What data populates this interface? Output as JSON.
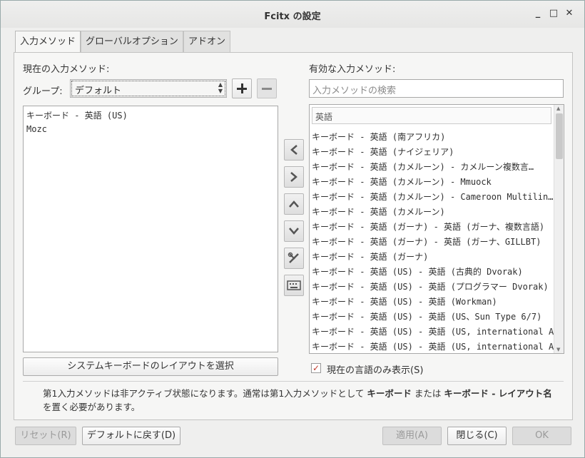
{
  "window": {
    "title": "Fcitx の設定",
    "controls": [
      "_",
      "□",
      "✕"
    ]
  },
  "tabs": [
    {
      "label": "入力メソッド",
      "active": true
    },
    {
      "label": "グローバルオプション",
      "active": false
    },
    {
      "label": "アドオン",
      "active": false
    }
  ],
  "left": {
    "heading": "現在の入力メソッド:",
    "group_label": "グループ:",
    "group_value": "デフォルト",
    "items": [
      "キーボード - 英語 (US)",
      "Mozc"
    ],
    "layout_button": "システムキーボードのレイアウトを選択"
  },
  "right": {
    "heading": "有効な入力メソッド:",
    "search_placeholder": "入力メソッドの検索",
    "group_header": "英語",
    "items": [
      "キーボード - 英語 (南アフリカ)",
      "キーボード - 英語 (ナイジェリア)",
      "キーボード - 英語 (カメルーン) - カメルーン複数言…",
      "キーボード - 英語 (カメルーン) - Mmuock",
      "キーボード - 英語 (カメルーン) - Cameroon Multilin…",
      "キーボード - 英語 (カメルーン)",
      "キーボード - 英語 (ガーナ) - 英語 (ガーナ、複数言語)",
      "キーボード - 英語 (ガーナ) - 英語 (ガーナ、GILLBT)",
      "キーボード - 英語 (ガーナ)",
      "キーボード - 英語 (US) - 英語 (古典的 Dvorak)",
      "キーボード - 英語 (US) - 英語 (プログラマー Dvorak)",
      "キーボード - 英語 (US) - 英語 (Workman)",
      "キーボード - 英語 (US) - 英語 (US、Sun Type 6/7)",
      "キーボード - 英語 (US) - 英語 (US, international A…",
      "キーボード - 英語 (US) - 英語 (US, international A…"
    ],
    "only_current_lang_label": "現在の言語のみ表示(S)",
    "only_current_lang_checked": true
  },
  "note": {
    "text1": "第1入力メソッドは非アクティブ状態になります。通常は第1入力メソッドとして ",
    "bold1": "キーボード",
    "text2": " または ",
    "bold2": "キーボード - レイアウト名",
    "text3": " を置く必要があります。"
  },
  "bottom": {
    "reset": "リセット(R)",
    "defaults": "デフォルトに戻す(D)",
    "apply": "適用(A)",
    "close": "閉じる(C)",
    "ok": "OK"
  },
  "colors": {
    "accent_check": "#c0392b",
    "background": "#efefee"
  }
}
